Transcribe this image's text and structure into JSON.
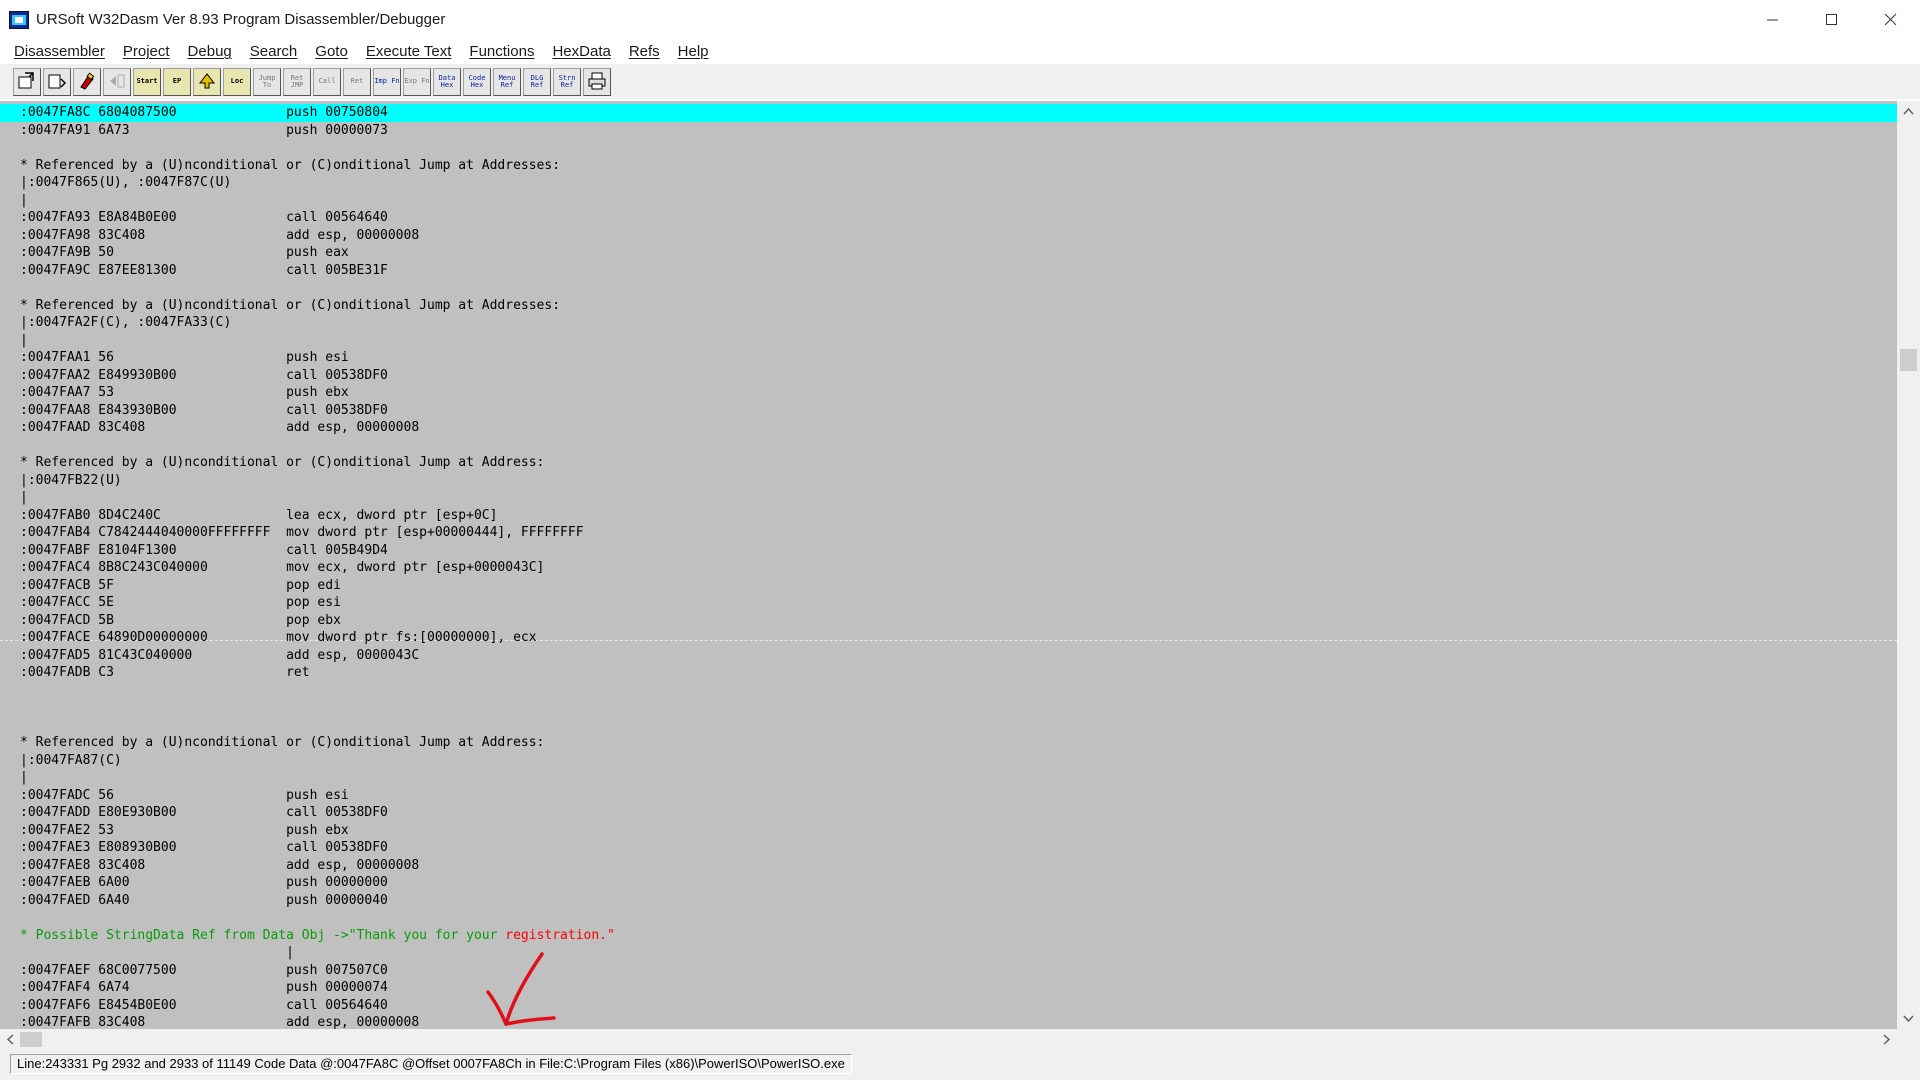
{
  "window": {
    "title": "URSoft W32Dasm Ver 8.93 Program Disassembler/Debugger",
    "minimize_icon": "minimize-icon",
    "maximize_icon": "maximize-icon",
    "close_icon": "close-icon"
  },
  "menu": [
    "Disassembler",
    "Project",
    "Debug",
    "Search",
    "Goto",
    "Execute Text",
    "Functions",
    "HexData",
    "Refs",
    "Help"
  ],
  "toolbar": [
    {
      "name": "open-file-icon",
      "label": "",
      "kind": "icon"
    },
    {
      "name": "save-project-icon",
      "label": "",
      "kind": "icon"
    },
    {
      "name": "font-icon",
      "label": "",
      "kind": "icon"
    },
    {
      "name": "goto-code-start-icon",
      "label": "",
      "kind": "icon"
    },
    {
      "name": "goto-program-entry-icon",
      "label": "Start",
      "kind": "yellow"
    },
    {
      "name": "goto-entry-point-icon",
      "label": "EP",
      "kind": "yellow"
    },
    {
      "name": "goto-page-icon",
      "label": "",
      "kind": "yellow"
    },
    {
      "name": "goto-location-icon",
      "label": "Loc",
      "kind": "yellow"
    },
    {
      "name": "jump-to-icon",
      "label": "Jump To",
      "kind": "dim"
    },
    {
      "name": "return-from-jump-icon",
      "label": "Ret JMP",
      "kind": "dim"
    },
    {
      "name": "execute-call-icon",
      "label": "Call",
      "kind": "dim"
    },
    {
      "name": "return-from-call-icon",
      "label": "Ret",
      "kind": "dim"
    },
    {
      "name": "imports-icon",
      "label": "Imp Fn",
      "kind": "active"
    },
    {
      "name": "exports-icon",
      "label": "Exp Fn",
      "kind": "dim"
    },
    {
      "name": "data-hex-icon",
      "label": "Data Hex",
      "kind": "active"
    },
    {
      "name": "code-hex-icon",
      "label": "Code Hex",
      "kind": "active"
    },
    {
      "name": "menu-ref-icon",
      "label": "Menu Ref",
      "kind": "active"
    },
    {
      "name": "dialog-ref-icon",
      "label": "DLG Ref",
      "kind": "active"
    },
    {
      "name": "string-ref-icon",
      "label": "Strn Ref",
      "kind": "active"
    },
    {
      "name": "print-icon",
      "label": "",
      "kind": "print"
    }
  ],
  "code_lines": [
    ":0047FA8C 6804087500              push 00750804",
    ":0047FA91 6A73                    push 00000073",
    "",
    "* Referenced by a (U)nconditional or (C)onditional Jump at Addresses:",
    "|:0047F865(U), :0047F87C(U)",
    "|",
    ":0047FA93 E8A84B0E00              call 00564640",
    ":0047FA98 83C408                  add esp, 00000008",
    ":0047FA9B 50                      push eax",
    ":0047FA9C E87EE81300              call 005BE31F",
    "",
    "* Referenced by a (U)nconditional or (C)onditional Jump at Addresses:",
    "|:0047FA2F(C), :0047FA33(C)",
    "|",
    ":0047FAA1 56                      push esi",
    ":0047FAA2 E849930B00              call 00538DF0",
    ":0047FAA7 53                      push ebx",
    ":0047FAA8 E843930B00              call 00538DF0",
    ":0047FAAD 83C408                  add esp, 00000008",
    "",
    "* Referenced by a (U)nconditional or (C)onditional Jump at Address:",
    "|:0047FB22(U)",
    "|",
    ":0047FAB0 8D4C240C                lea ecx, dword ptr [esp+0C]",
    ":0047FAB4 C7842444040000FFFFFFFF  mov dword ptr [esp+00000444], FFFFFFFF",
    ":0047FABF E8104F1300              call 005B49D4",
    ":0047FAC4 8B8C243C040000          mov ecx, dword ptr [esp+0000043C]",
    ":0047FACB 5F                      pop edi",
    ":0047FACC 5E                      pop esi",
    ":0047FACD 5B                      pop ebx",
    ":0047FACE 64890D00000000          mov dword ptr fs:[00000000], ecx",
    ":0047FAD5 81C43C040000            add esp, 0000043C",
    ":0047FADB C3                      ret",
    "",
    "",
    "",
    "* Referenced by a (U)nconditional or (C)onditional Jump at Address:",
    "|:0047FA87(C)",
    "|",
    ":0047FADC 56                      push esi",
    ":0047FADD E80E930B00              call 00538DF0",
    ":0047FAE2 53                      push ebx",
    ":0047FAE3 E808930B00              call 00538DF0",
    ":0047FAE8 83C408                  add esp, 00000008",
    ":0047FAEB 6A00                    push 00000000",
    ":0047FAED 6A40                    push 00000040",
    "",
    "* Possible StringData Ref from Data Obj ->\"Thank you for your ",
    "                                  |",
    ":0047FAEF 68C0077500              push 007507C0",
    ":0047FAF4 6A74                    push 00000074",
    ":0047FAF6 E8454B0E00              call 00564640",
    ":0047FAFB 83C408                  add esp, 00000008"
  ],
  "string_ref_tail": "registration.\"",
  "status_text": "Line:243331 Pg 2932 and 2933 of 11149  Code Data @:0047FA8C @Offset 0007FA8Ch in File:C:\\Program Files (x86)\\PowerISO\\PowerISO.exe",
  "colors": {
    "highlight": "#00ffff",
    "code_bg": "#c0c0c0",
    "string_ref": "#079d07",
    "string_emphasis": "#ff0000",
    "annotation": "#e0101a"
  }
}
